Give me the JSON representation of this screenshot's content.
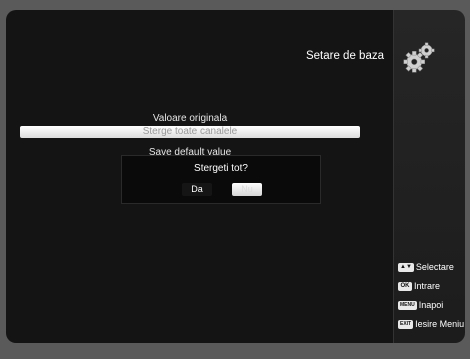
{
  "header": {
    "title": "Setare de baza",
    "icon": "gears-icon"
  },
  "menu": {
    "items": [
      {
        "label": "Valoare originala"
      },
      {
        "label": "Sterge toate canalele"
      },
      {
        "label": "Save default value"
      }
    ],
    "selected_index": 1
  },
  "dialog": {
    "message": "Stergeti tot?",
    "yes_label": "Da",
    "no_label": "Nu",
    "focused": "no"
  },
  "help": {
    "items": [
      {
        "key": "▲▼",
        "label": "Selectare",
        "icon": "updown-key-icon"
      },
      {
        "key": "OK",
        "label": "Intrare",
        "icon": "ok-key-icon"
      },
      {
        "key": "MENU",
        "label": "Inapoi",
        "icon": "menu-key-icon"
      },
      {
        "key": "EXIT",
        "label": "Iesire Meniu",
        "icon": "exit-key-icon"
      }
    ]
  },
  "colors": {
    "background": "#141414",
    "frame": "#5a5a5a",
    "highlight": "#ffffff",
    "text": "#ffffff"
  }
}
